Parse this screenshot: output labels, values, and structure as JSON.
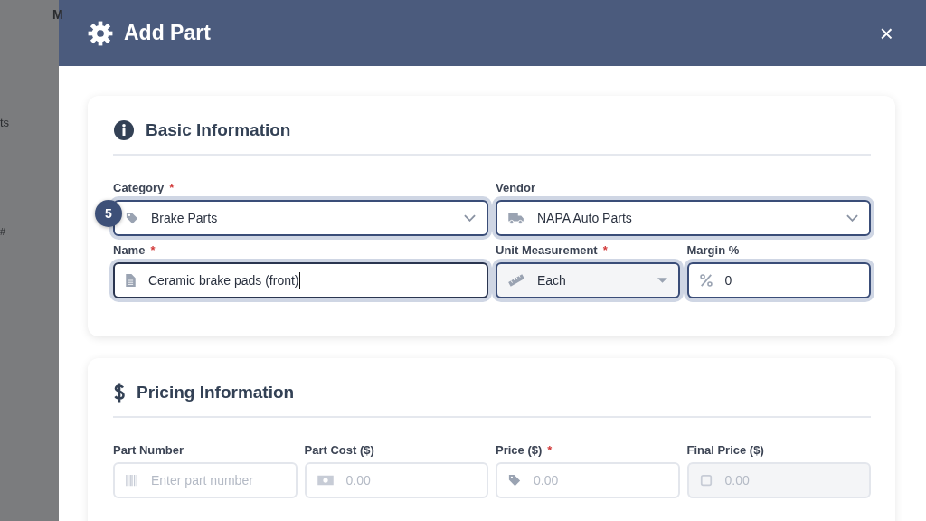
{
  "background": {
    "texts": [
      "M",
      "ts",
      "#"
    ]
  },
  "modal": {
    "title": "Add Part",
    "close": "×",
    "sections": [
      {
        "title": "Basic Information",
        "fields": [
          {
            "label": "Category",
            "required_mark": "*",
            "kind": "select",
            "value": "Brake Parts",
            "badge": "5"
          },
          {
            "label": "Vendor",
            "kind": "select",
            "value": "NAPA Auto Parts"
          },
          {
            "label": "Name",
            "required_mark": "*",
            "kind": "text",
            "value": "Ceramic brake pads (front)",
            "focused": true
          },
          {
            "label": "Unit Measurement",
            "required_mark": "*",
            "kind": "select-small",
            "value": "Each"
          },
          {
            "label": "Margin %",
            "kind": "text",
            "value": "0"
          }
        ]
      },
      {
        "title": "Pricing Information",
        "fields": [
          {
            "label": "Part Number",
            "kind": "plain",
            "placeholder": "Enter part number"
          },
          {
            "label": "Part Cost ($)",
            "kind": "plain",
            "placeholder": "0.00"
          },
          {
            "label": "Price ($)",
            "required_mark": "*",
            "kind": "plain",
            "placeholder": "0.00"
          },
          {
            "label": "Final Price ($)",
            "kind": "readonly",
            "placeholder": "0.00"
          }
        ]
      }
    ]
  }
}
